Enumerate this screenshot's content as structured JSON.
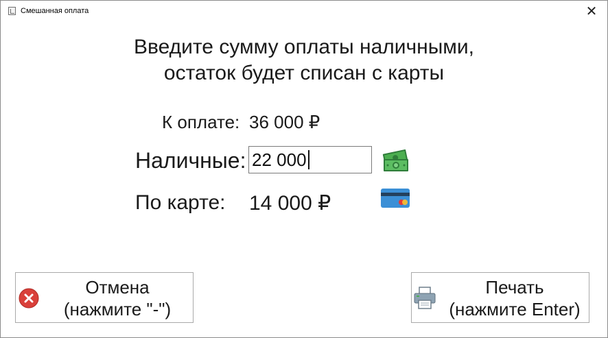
{
  "window": {
    "title": "Смешанная оплата",
    "close_glyph": "✕"
  },
  "heading": {
    "line1": "Введите сумму оплаты наличными,",
    "line2": "остаток будет списан с карты"
  },
  "amount_due": {
    "label": "К оплате:",
    "value": "36 000 ₽"
  },
  "cash": {
    "label": "Наличные:",
    "value": "22 000",
    "icon": "money-icon"
  },
  "card": {
    "label": "По карте:",
    "value": "14 000 ₽",
    "icon": "credit-card-icon"
  },
  "buttons": {
    "cancel": {
      "line1": "Отмена",
      "line2": "(нажмите \"-\")",
      "icon": "cancel-icon"
    },
    "print": {
      "line1": "Печать",
      "line2": "(нажмите Enter)",
      "icon": "printer-icon"
    }
  },
  "colors": {
    "cancel_red": "#d9403a",
    "money_green": "#3f9a48",
    "card_blue": "#3b8fd6"
  }
}
